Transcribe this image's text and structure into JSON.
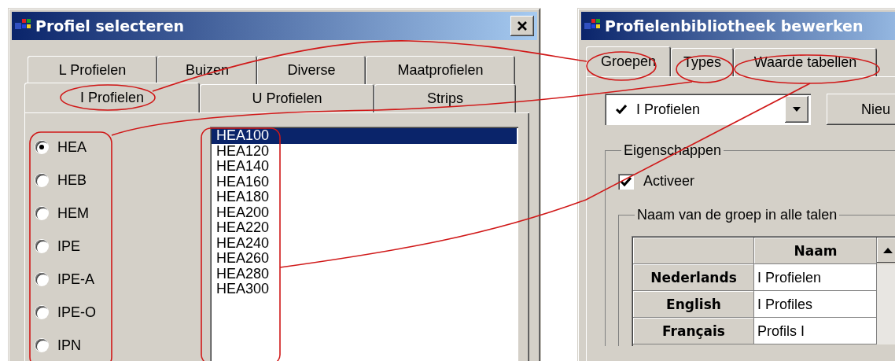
{
  "left_window": {
    "title": "Profiel selecteren",
    "tab_rows": [
      [
        {
          "label": "L Profielen",
          "selected": false
        },
        {
          "label": "Buizen",
          "selected": false
        },
        {
          "label": "Diverse",
          "selected": false
        },
        {
          "label": "Maatprofielen",
          "selected": false
        }
      ],
      [
        {
          "label": "I Profielen",
          "selected": true
        },
        {
          "label": "U Profielen",
          "selected": false
        },
        {
          "label": "Strips",
          "selected": false
        }
      ]
    ],
    "profile_types": [
      {
        "label": "HEA",
        "selected": true
      },
      {
        "label": "HEB",
        "selected": false
      },
      {
        "label": "HEM",
        "selected": false
      },
      {
        "label": "IPE",
        "selected": false
      },
      {
        "label": "IPE-A",
        "selected": false
      },
      {
        "label": "IPE-O",
        "selected": false
      },
      {
        "label": "IPN",
        "selected": false
      }
    ],
    "profiles": [
      {
        "label": "HEA100",
        "selected": true
      },
      {
        "label": "HEA120",
        "selected": false
      },
      {
        "label": "HEA140",
        "selected": false
      },
      {
        "label": "HEA160",
        "selected": false
      },
      {
        "label": "HEA180",
        "selected": false
      },
      {
        "label": "HEA200",
        "selected": false
      },
      {
        "label": "HEA220",
        "selected": false
      },
      {
        "label": "HEA240",
        "selected": false
      },
      {
        "label": "HEA260",
        "selected": false
      },
      {
        "label": "HEA280",
        "selected": false
      },
      {
        "label": "HEA300",
        "selected": false
      }
    ]
  },
  "right_window": {
    "title": "Profielenbibliotheek bewerken",
    "tabs": [
      {
        "label": "Groepen",
        "selected": true
      },
      {
        "label": "Types",
        "selected": false
      },
      {
        "label": "Waarde tabellen",
        "selected": false
      }
    ],
    "group_select": {
      "value": "I Profielen",
      "checked": true
    },
    "new_button": "Nieu",
    "properties": {
      "legend": "Eigenschappen",
      "activate": {
        "label": "Activeer",
        "checked": true
      },
      "names": {
        "legend": "Naam van de groep in alle talen",
        "column": "Naam",
        "rows": [
          {
            "language": "Nederlands",
            "name": "I Profielen"
          },
          {
            "language": "English",
            "name": "I Profiles"
          },
          {
            "language": "Français",
            "name": "Profils I"
          }
        ]
      }
    }
  }
}
